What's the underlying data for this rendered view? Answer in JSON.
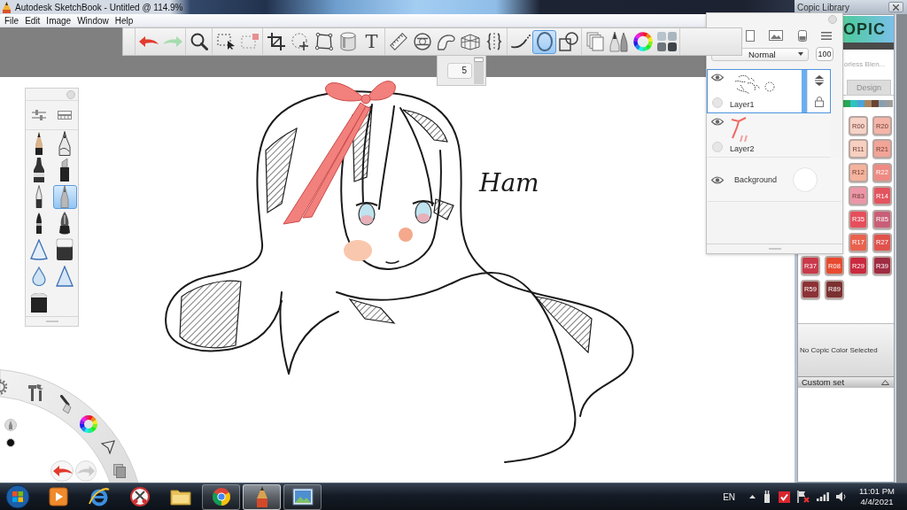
{
  "window": {
    "title": "Autodesk SketchBook - Untitled @ 114.9%"
  },
  "menu": [
    "File",
    "Edit",
    "Image",
    "Window",
    "Help"
  ],
  "toolbar": {
    "groups": [
      {
        "tools": [
          {
            "kind": "undo",
            "selected": false
          },
          {
            "kind": "redo",
            "selected": false
          }
        ]
      },
      {
        "tools": [
          {
            "kind": "zoom",
            "selected": false
          }
        ]
      },
      {
        "tools": [
          {
            "kind": "select",
            "selected": false
          },
          {
            "kind": "deselect",
            "selected": false
          }
        ]
      },
      {
        "tools": [
          {
            "kind": "crop",
            "selected": false
          },
          {
            "kind": "move",
            "selected": false
          },
          {
            "kind": "distort",
            "selected": false
          },
          {
            "kind": "fill",
            "selected": false
          },
          {
            "kind": "text",
            "label": "T",
            "selected": false
          }
        ]
      },
      {
        "tools": [
          {
            "kind": "ruler",
            "selected": false
          },
          {
            "kind": "ellipseguide",
            "selected": false
          },
          {
            "kind": "curve",
            "selected": false
          },
          {
            "kind": "perspective",
            "selected": false
          },
          {
            "kind": "symmetry",
            "selected": false
          }
        ]
      },
      {
        "tools": [
          {
            "kind": "stroke",
            "selected": false
          },
          {
            "kind": "ellipse",
            "selected": true
          },
          {
            "kind": "shapes",
            "selected": false
          }
        ]
      },
      {
        "tools": [
          {
            "kind": "layers",
            "selected": false
          },
          {
            "kind": "brushes",
            "selected": false
          },
          {
            "kind": "colorwheel",
            "selected": false
          },
          {
            "kind": "copic",
            "selected": false
          }
        ]
      }
    ]
  },
  "brush_size": {
    "value": "5",
    "level": 0.95
  },
  "brush_palette": {
    "brushes": [
      {
        "kind": "pencil",
        "selected": false
      },
      {
        "kind": "inkpen",
        "selected": false
      },
      {
        "kind": "marker",
        "selected": false
      },
      {
        "kind": "chisel",
        "selected": false
      },
      {
        "kind": "fineliner",
        "selected": false
      },
      {
        "kind": "airbrush",
        "selected": true
      },
      {
        "kind": "brushpen",
        "selected": false
      },
      {
        "kind": "nib",
        "selected": false
      },
      {
        "kind": "soft",
        "selected": false
      },
      {
        "kind": "eraser",
        "selected": false
      },
      {
        "kind": "blur",
        "selected": false
      },
      {
        "kind": "hard",
        "selected": false
      },
      {
        "kind": "block",
        "selected": false
      }
    ]
  },
  "canvas": {
    "handwriting": "Ham"
  },
  "layers": {
    "blend_mode": "Normal",
    "opacity": "100",
    "items": [
      {
        "name": "Layer1",
        "kind": "sketch",
        "visible": true,
        "selected": true
      },
      {
        "name": "Layer2",
        "kind": "ribbon",
        "visible": true,
        "selected": false
      },
      {
        "name": "Background",
        "kind": "background",
        "visible": true,
        "selected": false
      }
    ]
  },
  "copic": {
    "title": "Copic Library",
    "logo": "OPIC",
    "library": "orless Blen...",
    "tabs": [
      {
        "label": "Design",
        "selected": false
      }
    ],
    "families": [
      {
        "color": "#2aa654"
      },
      {
        "color": "#2fc2c0"
      },
      {
        "color": "#4da3d8"
      },
      {
        "color": "#a7855f"
      },
      {
        "color": "#6a4535"
      },
      {
        "color": "#8aa0b0"
      },
      {
        "color": "#9e9e9e"
      }
    ],
    "swatch_rows": [
      [
        {
          "label": "R00",
          "color": "#f6d3c6"
        },
        {
          "label": "R20",
          "color": "#f4b5a8"
        }
      ],
      [
        {
          "label": "R11",
          "color": "#f7d0c1"
        },
        {
          "label": "R21",
          "color": "#f2a497"
        }
      ],
      [
        {
          "label": "R12",
          "color": "#f4b39c"
        },
        {
          "label": "R22",
          "color": "#ee8a83"
        }
      ],
      [
        {
          "label": "R83",
          "color": "#ec97a9"
        },
        {
          "label": "R14",
          "color": "#e4545f"
        }
      ],
      [
        {
          "label": "R35",
          "color": "#e64e5c"
        },
        {
          "label": "R85",
          "color": "#c85f78"
        }
      ],
      [
        {
          "label": "R17",
          "color": "#e9624e"
        },
        {
          "label": "R27",
          "color": "#e0524d"
        }
      ],
      [
        {
          "label": "R37",
          "color": "#c93a4b"
        },
        {
          "label": "R08",
          "color": "#e84a2f"
        },
        {
          "label": "R29",
          "color": "#ca2a3f"
        },
        {
          "label": "R39",
          "color": "#a02c42"
        }
      ],
      [
        {
          "label": "R59",
          "color": "#8d3236"
        },
        {
          "label": "R89",
          "color": "#7b3131"
        }
      ]
    ],
    "status": "No Copic Color Selected",
    "custom_set": "Custom set"
  },
  "taskbar": {
    "apps": [
      {
        "kind": "mediaplayer",
        "running": false,
        "selected": false
      },
      {
        "kind": "ie",
        "running": false,
        "selected": false
      },
      {
        "kind": "snipping",
        "running": false,
        "selected": false
      },
      {
        "kind": "explorer",
        "running": false,
        "selected": false
      },
      {
        "kind": "chrome",
        "running": true,
        "selected": false
      },
      {
        "kind": "sketchbook",
        "running": true,
        "selected": true
      },
      {
        "kind": "photos",
        "running": true,
        "selected": false
      }
    ],
    "language": "EN",
    "time": "11:01 PM",
    "date": "4/4/2021"
  }
}
